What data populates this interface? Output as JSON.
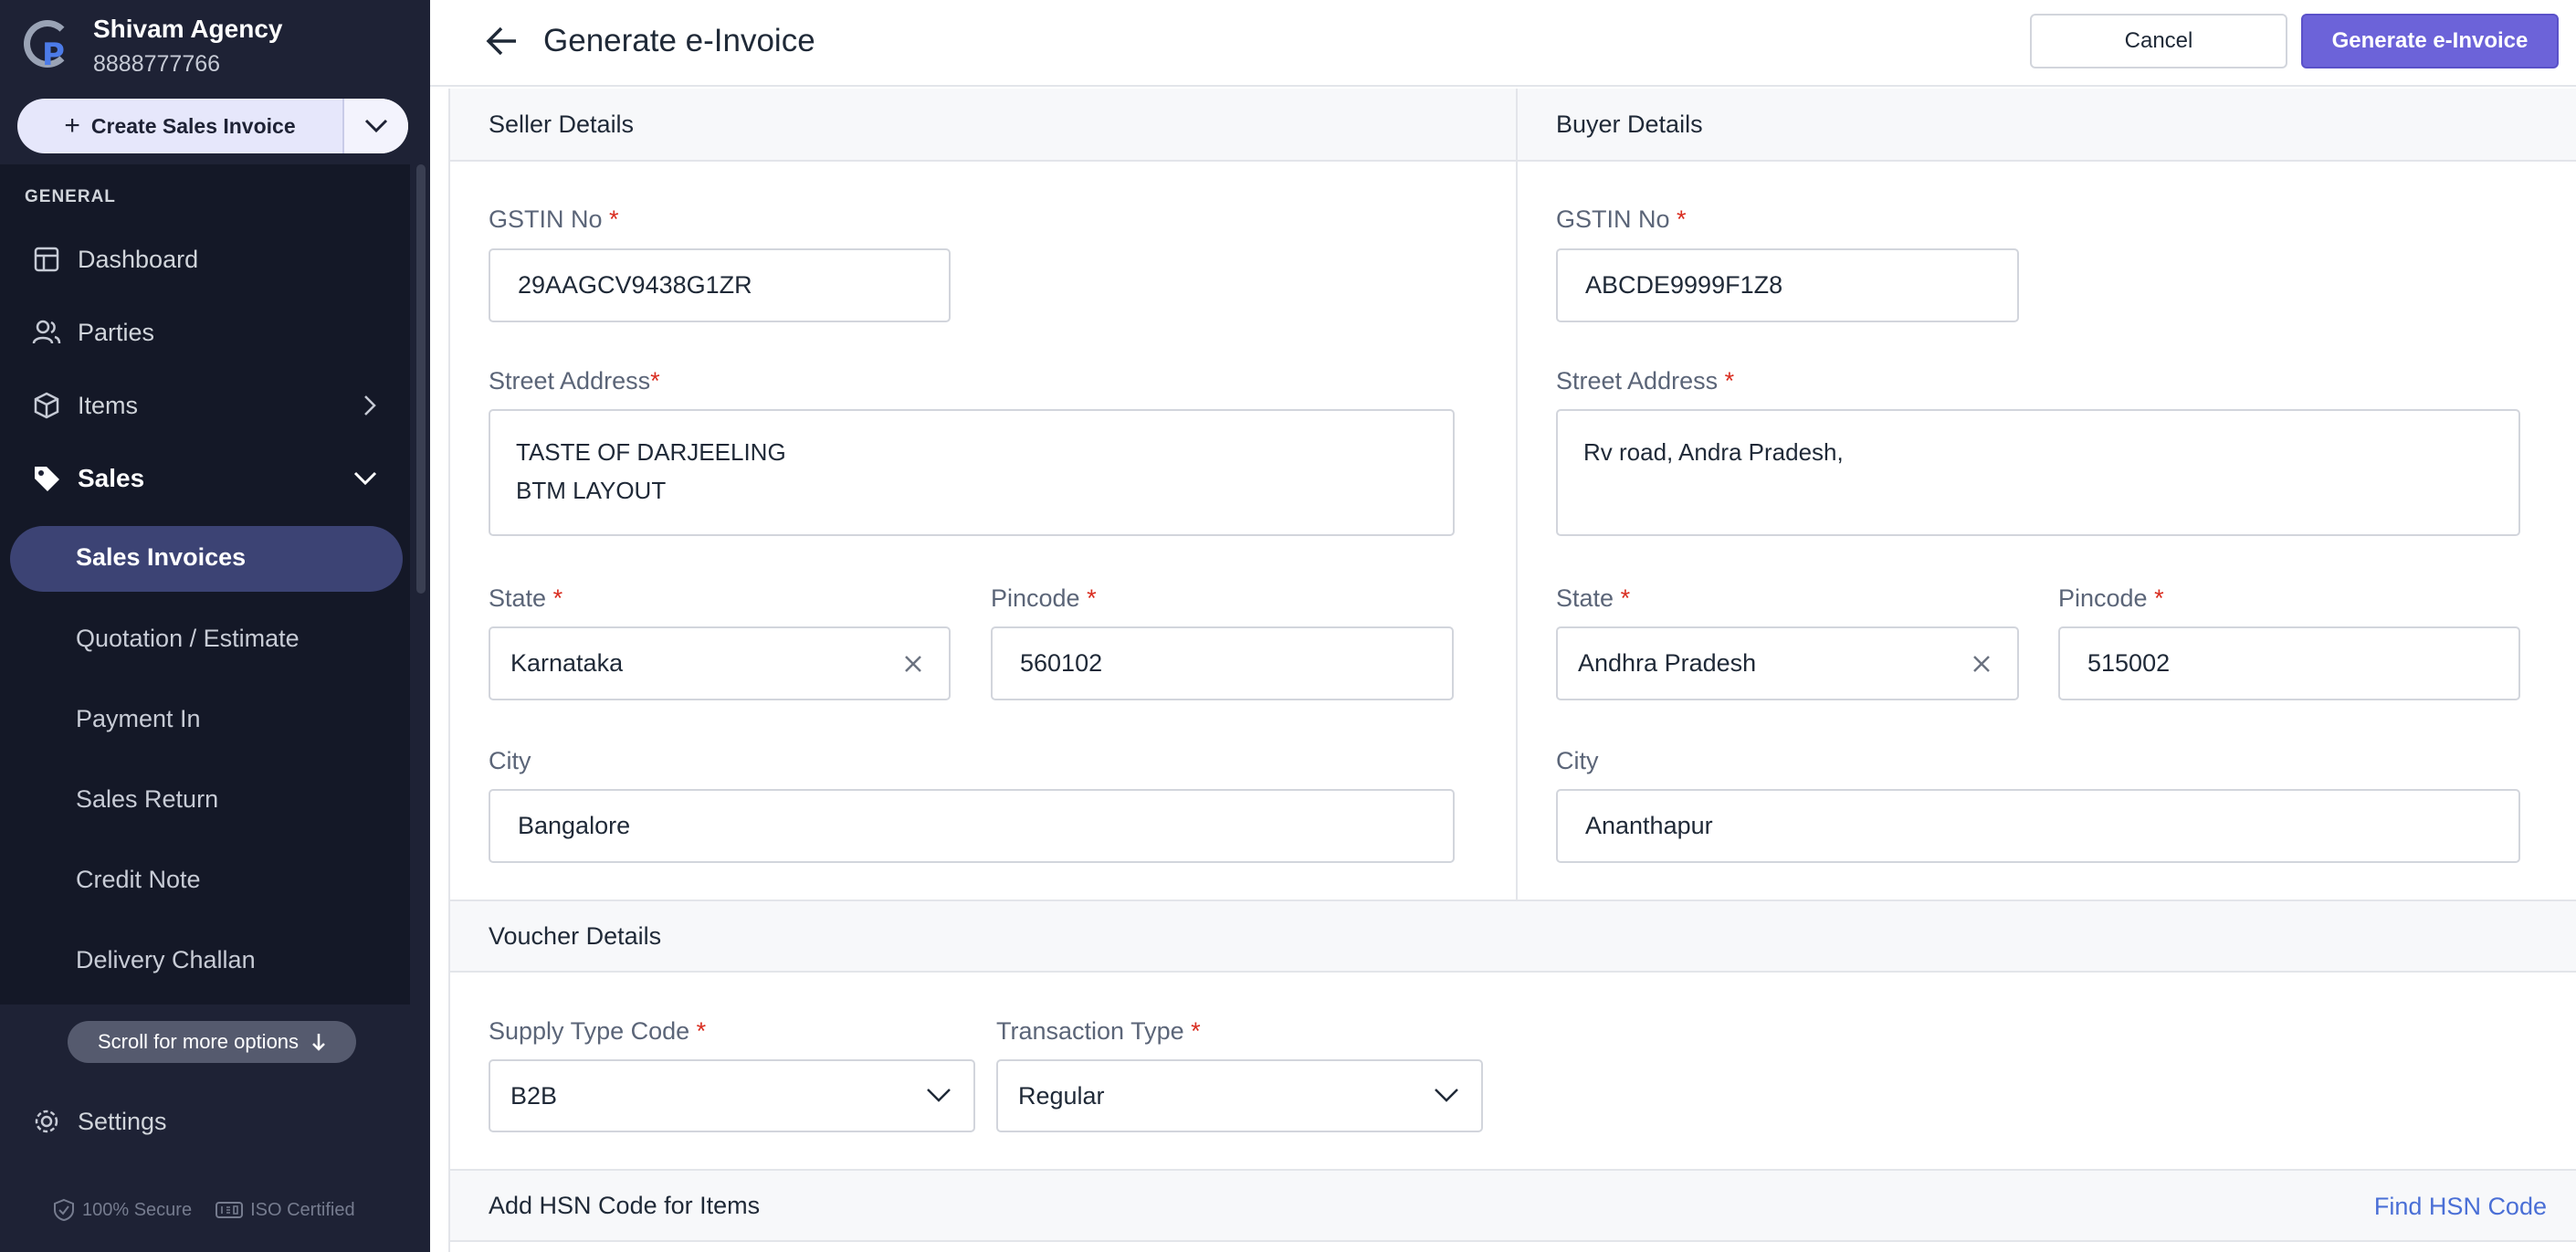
{
  "sidebar": {
    "business_name": "Shivam Agency",
    "phone": "8888777766",
    "create_button": "Create Sales Invoice",
    "section_general": "GENERAL",
    "nav": {
      "dashboard": "Dashboard",
      "parties": "Parties",
      "items": "Items",
      "sales": "Sales"
    },
    "sales_sub": {
      "invoices": "Sales Invoices",
      "quotation": "Quotation / Estimate",
      "payment_in": "Payment In",
      "sales_return": "Sales Return",
      "credit_note": "Credit Note",
      "delivery_challan": "Delivery Challan"
    },
    "scroll_hint": "Scroll for more options",
    "settings": "Settings",
    "badge_secure": "100% Secure",
    "badge_iso": "ISO Certified"
  },
  "header": {
    "title": "Generate e-Invoice",
    "cancel": "Cancel",
    "generate": "Generate e-Invoice"
  },
  "seller": {
    "section_title": "Seller Details",
    "gstin_label": "GSTIN No",
    "gstin": "29AAGCV9438G1ZR",
    "address_label": "Street Address",
    "address_line1": "TASTE OF DARJEELING",
    "address_line2": "BTM LAYOUT",
    "state_label": "State",
    "state": "Karnataka",
    "pincode_label": "Pincode",
    "pincode": "560102",
    "city_label": "City",
    "city": "Bangalore"
  },
  "buyer": {
    "section_title": "Buyer Details",
    "gstin_label": "GSTIN No",
    "gstin": "ABCDE9999F1Z8",
    "address_label": "Street Address",
    "address_line1": "Rv road, Andra Pradesh,",
    "state_label": "State",
    "state": "Andhra Pradesh",
    "pincode_label": "Pincode",
    "pincode": "515002",
    "city_label": "City",
    "city": "Ananthapur"
  },
  "voucher": {
    "section_title": "Voucher Details",
    "supply_label": "Supply Type Code",
    "supply_value": "B2B",
    "transaction_label": "Transaction Type",
    "transaction_value": "Regular"
  },
  "hsn": {
    "section_title": "Add HSN Code for Items",
    "find_link": "Find HSN Code"
  },
  "required_mark": "*",
  "colors": {
    "sidebar_bg": "#1e2235",
    "accent": "#6c63d9",
    "link": "#4a6fd6",
    "required": "#d92d20"
  }
}
